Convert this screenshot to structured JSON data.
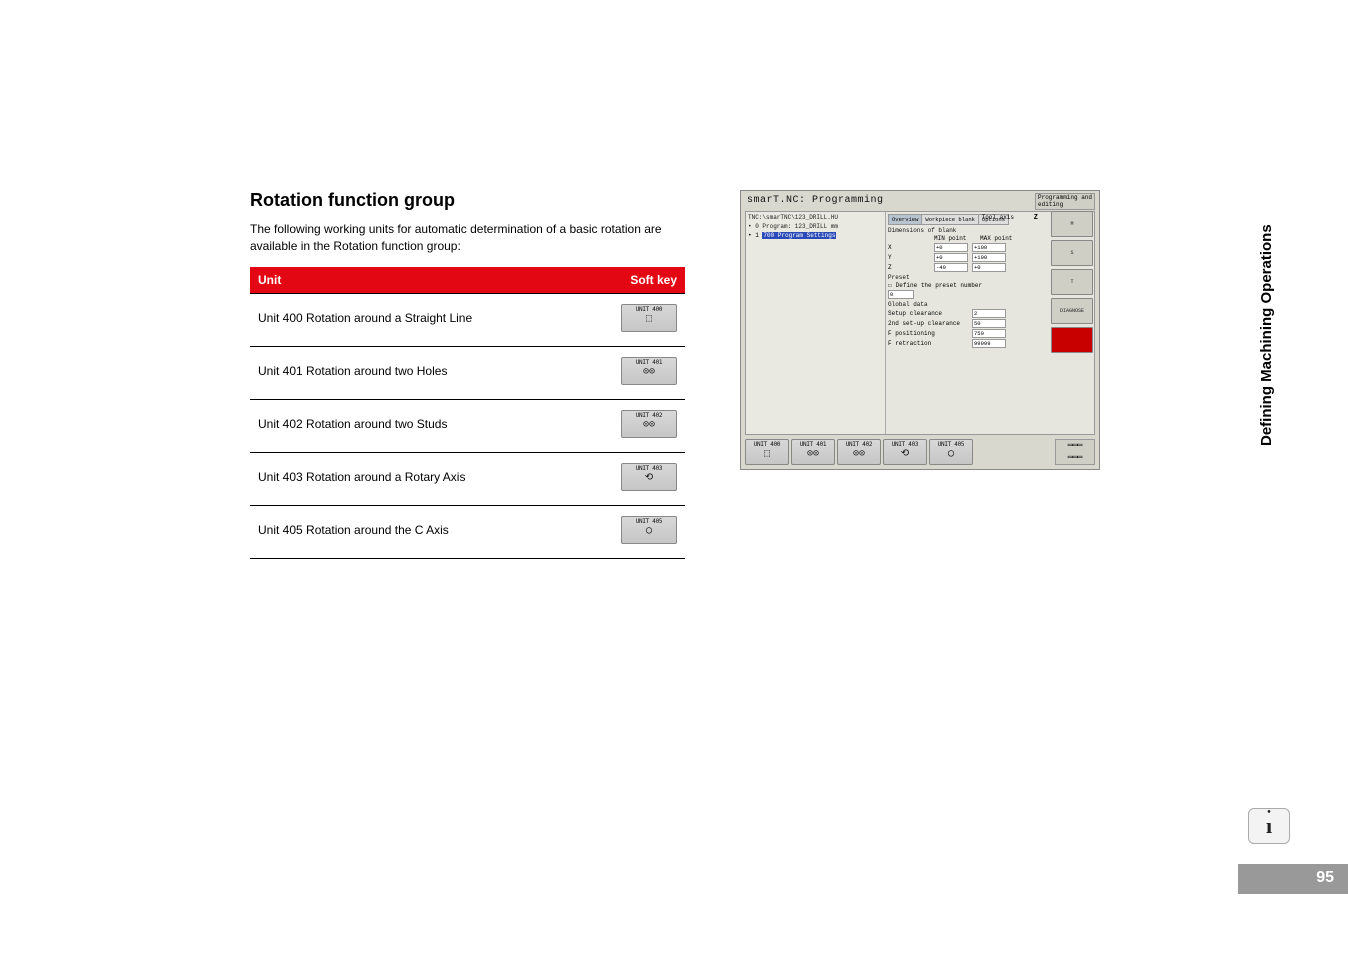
{
  "heading": "Rotation function group",
  "intro": "The following working units for automatic determination of a basic rotation are available in the Rotation function group:",
  "table": {
    "col_unit": "Unit",
    "col_softkey": "Soft key",
    "rows": [
      {
        "desc": "Unit 400 Rotation around a Straight Line",
        "key": "UNIT 400",
        "glyph": "⬚"
      },
      {
        "desc": "Unit 401 Rotation around two Holes",
        "key": "UNIT 401",
        "glyph": "⊙⊙"
      },
      {
        "desc": "Unit 402 Rotation around two Studs",
        "key": "UNIT 402",
        "glyph": "⊙⊙"
      },
      {
        "desc": "Unit 403 Rotation around a Rotary Axis",
        "key": "UNIT 403",
        "glyph": "⟲"
      },
      {
        "desc": "Unit 405 Rotation around the C Axis",
        "key": "UNIT 405",
        "glyph": "◯"
      }
    ]
  },
  "screenshot": {
    "title": "smarT.NC: Programming",
    "mode": "Programming and editing",
    "tree_path": "TNC:\\smarTNC\\123_DRILL.HU",
    "tree_prog": "Program: 123_DRILL mm",
    "tree_item": "700 Program Settings",
    "tool_axis_label": "Tool axis",
    "tool_axis_value": "Z",
    "tabs": {
      "overview": "Overview",
      "workpiece": "Workpiece blank",
      "options": "Options"
    },
    "dim_label": "Dimensions of blank",
    "min_label": "MIN point",
    "max_label": "MAX point",
    "x": {
      "label": "X",
      "min": "+0",
      "max": "+100"
    },
    "y": {
      "label": "Y",
      "min": "+0",
      "max": "+100"
    },
    "z": {
      "label": "Z",
      "min": "-40",
      "max": "+0"
    },
    "preset_label": "Preset",
    "preset_define": "Define the preset number",
    "preset_value": "0",
    "global_label": "Global data",
    "setup_clear": {
      "label": "Setup clearance",
      "value": "2"
    },
    "second_clear": {
      "label": "2nd set-up clearance",
      "value": "50"
    },
    "f_pos": {
      "label": "F positioning",
      "value": "750"
    },
    "f_retr": {
      "label": "F retraction",
      "value": "99999"
    },
    "rbtn_diag": "DIAGNOSE",
    "sk": [
      "UNIT 400",
      "UNIT 401",
      "UNIT 402",
      "UNIT 403",
      "UNIT 405"
    ],
    "rsidebar_m": "M",
    "rsidebar_s": "S",
    "rsidebar_t": "T"
  },
  "side_label": "Defining Machining Operations",
  "page_number": "95"
}
